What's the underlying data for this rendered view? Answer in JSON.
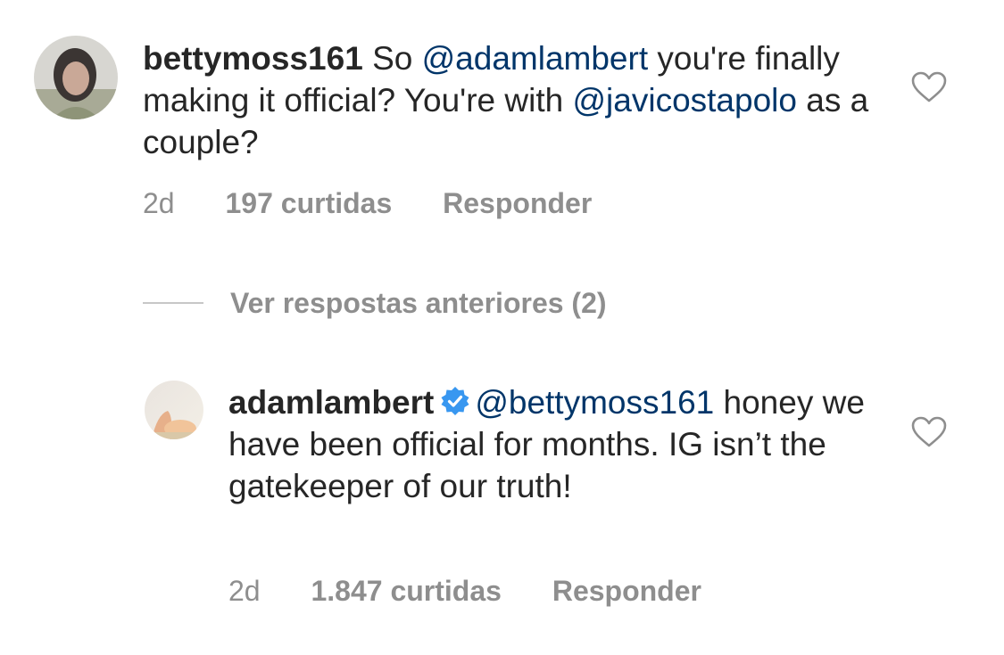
{
  "comments": [
    {
      "username": "bettymoss161",
      "verified": false,
      "text_parts": [
        "So ",
        "@adamlambert",
        " you're finally making it official?  You're with ",
        "@javicostapolo",
        " as a couple?"
      ],
      "time": "2d",
      "likes": "197 curtidas",
      "reply": "Responder",
      "avatar_icon": "profile-photo"
    },
    {
      "username": "adamlambert",
      "verified": true,
      "text_parts": [
        "@bettymoss161",
        " honey we have been official for months. IG isn’t the gatekeeper of our truth!"
      ],
      "time": "2d",
      "likes": "1.847 curtidas",
      "reply": "Responder",
      "avatar_icon": "profile-photo"
    }
  ],
  "view_replies": {
    "label": "Ver respostas anteriores (2)"
  },
  "icons": {
    "like": "heart-outline-icon",
    "verified": "verified-badge-icon"
  },
  "colors": {
    "text": "#262626",
    "mention": "#003569",
    "secondary": "#8e8e8e",
    "verified": "#3897f0"
  }
}
